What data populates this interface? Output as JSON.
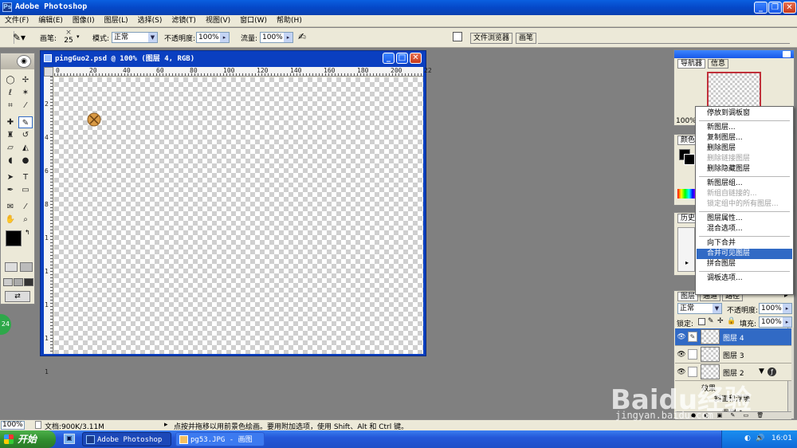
{
  "app": {
    "title": "Adobe Photoshop"
  },
  "menu": [
    "文件(F)",
    "编辑(E)",
    "图像(I)",
    "图层(L)",
    "选择(S)",
    "滤镜(T)",
    "视图(V)",
    "窗口(W)",
    "帮助(H)"
  ],
  "options": {
    "brush_label": "画笔:",
    "brush_size": "25",
    "mode_label": "模式:",
    "mode_value": "正常",
    "opacity_label": "不透明度:",
    "opacity_value": "100%",
    "flow_label": "流量:",
    "flow_value": "100%",
    "file_browser_tab": "文件浏览器",
    "brushes_tab": "画笔"
  },
  "document": {
    "title": "pingGuo2.psd @ 100% (图层 4, RGB)",
    "ruler_top": [
      "0",
      "20",
      "40",
      "60",
      "80",
      "100",
      "120",
      "140",
      "160",
      "180",
      "200",
      "22"
    ],
    "ruler_left": [
      "2",
      "4",
      "6",
      "8",
      "1",
      "1",
      "1",
      "1",
      "1"
    ]
  },
  "navigator": {
    "tab": "导航器",
    "info_tab": "信息",
    "zoom": "100%"
  },
  "color_panel": {
    "tab": "颜色"
  },
  "history_panel": {
    "tab": "历史"
  },
  "context_menu": [
    {
      "label": "停放到调板窗",
      "state": "normal"
    },
    {
      "sep": true
    },
    {
      "label": "新图层...",
      "state": "normal"
    },
    {
      "label": "复制图层...",
      "state": "normal"
    },
    {
      "label": "删除图层",
      "state": "normal"
    },
    {
      "label": "删除链接图层",
      "state": "disabled"
    },
    {
      "label": "删除隐藏图层",
      "state": "normal"
    },
    {
      "sep": true
    },
    {
      "label": "新图层组...",
      "state": "normal"
    },
    {
      "label": "新组自链接的...",
      "state": "disabled"
    },
    {
      "label": "锁定组中的所有图层...",
      "state": "disabled"
    },
    {
      "sep": true
    },
    {
      "label": "图层属性...",
      "state": "normal"
    },
    {
      "label": "混合选项...",
      "state": "normal"
    },
    {
      "sep": true
    },
    {
      "label": "向下合并",
      "state": "normal"
    },
    {
      "label": "合并可见图层",
      "state": "highlighted"
    },
    {
      "label": "拼合图层",
      "state": "normal"
    },
    {
      "sep": true
    },
    {
      "label": "调板选项...",
      "state": "normal"
    }
  ],
  "layers_panel": {
    "tabs": [
      "图层",
      "通道",
      "路径"
    ],
    "blend_mode": "正常",
    "opacity_label": "不透明度:",
    "opacity_value": "100%",
    "lock_label": "锁定:",
    "fill_label": "填充:",
    "fill_value": "100%",
    "layers": [
      {
        "name": "图层 4",
        "selected": true
      },
      {
        "name": "图层 3",
        "selected": false
      },
      {
        "name": "图层 2",
        "selected": false
      }
    ],
    "effects_label": "效果",
    "bevel_label": "斜面和浮雕",
    "partial_layer": "图层 1"
  },
  "statusbar": {
    "zoom": "100%",
    "doc_size": "文档:900K/3.11M",
    "hint": "点按并拖移以用前景色绘画。要用附加选项，使用 Shift、Alt 和 Ctrl 键。"
  },
  "taskbar": {
    "start": "开始",
    "items": [
      "Adobe Photoshop",
      "pg53.JPG - 画图"
    ],
    "clock": "16:01"
  },
  "watermark": {
    "brand": "Baidu经验",
    "url": "jingyan.baidu.com"
  },
  "colors": {
    "titlebar": "#0548c8",
    "highlight": "#316ac5",
    "taskbar": "#2458d8",
    "start": "#2e8a2c"
  }
}
